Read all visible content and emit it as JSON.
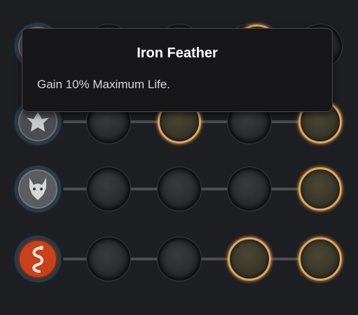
{
  "tooltip": {
    "title": "Iron Feather",
    "description": "Gain 10% Maximum Life."
  },
  "rows": [
    {
      "emblem_icon": "bird-emblem-icon",
      "nodes_active": [
        false,
        false,
        false,
        true,
        false
      ]
    },
    {
      "emblem_icon": "bird-emblem-icon",
      "nodes_active": [
        false,
        false,
        true,
        false,
        true
      ]
    },
    {
      "emblem_icon": "wolf-emblem-icon",
      "nodes_active": [
        false,
        false,
        false,
        false,
        true
      ]
    },
    {
      "emblem_icon": "serpent-emblem-icon",
      "nodes_active": [
        false,
        false,
        false,
        true,
        true
      ]
    }
  ],
  "colors": {
    "background": "#1e1f23",
    "active_ring": "#e2a65a",
    "serpent_emblem": "#c8401c"
  }
}
